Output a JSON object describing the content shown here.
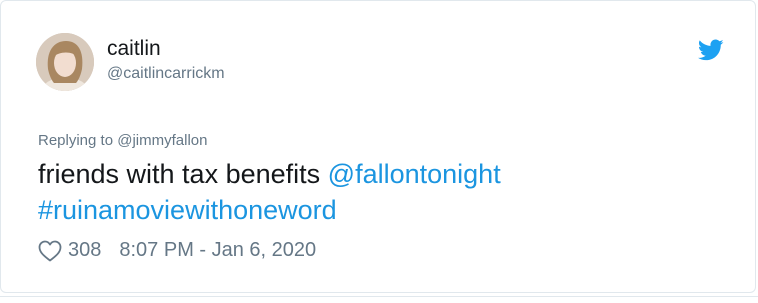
{
  "tweet": {
    "author": {
      "name": "caitlin",
      "handle": "@caitlincarrickm"
    },
    "replying_to": {
      "prefix": "Replying to",
      "mention": "@jimmyfallon"
    },
    "text": {
      "body": "friends with tax benefits",
      "mention": "@fallontonight",
      "hashtag": "#ruinamoviewithoneword"
    },
    "likes": "308",
    "timestamp": "8:07 PM - Jan 6, 2020"
  },
  "icons": {
    "brand": "twitter-bird-icon",
    "like": "heart-icon"
  },
  "colors": {
    "link": "#1b95e0",
    "muted": "#657786",
    "text": "#14171a",
    "border": "#e1e8ed"
  }
}
